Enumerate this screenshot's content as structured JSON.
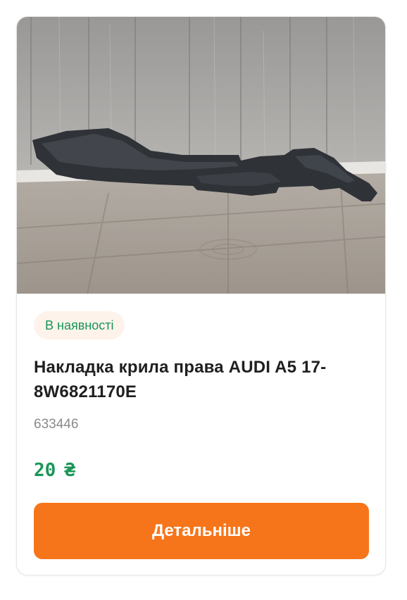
{
  "product": {
    "image_alt": "Накладка крила права AUDI A5 17- 8W6821170E",
    "availability": "В наявності",
    "title": "Накладка крила права AUDI A5 17- 8W6821170E",
    "sku": "633446",
    "price_value": "20",
    "price_currency": "₴",
    "details_button": "Детальніше"
  },
  "colors": {
    "availability_text": "#19955a",
    "availability_bg": "#fdf3ea",
    "price": "#1b9659",
    "button_bg": "#f7751a",
    "button_text": "#ffffff"
  }
}
